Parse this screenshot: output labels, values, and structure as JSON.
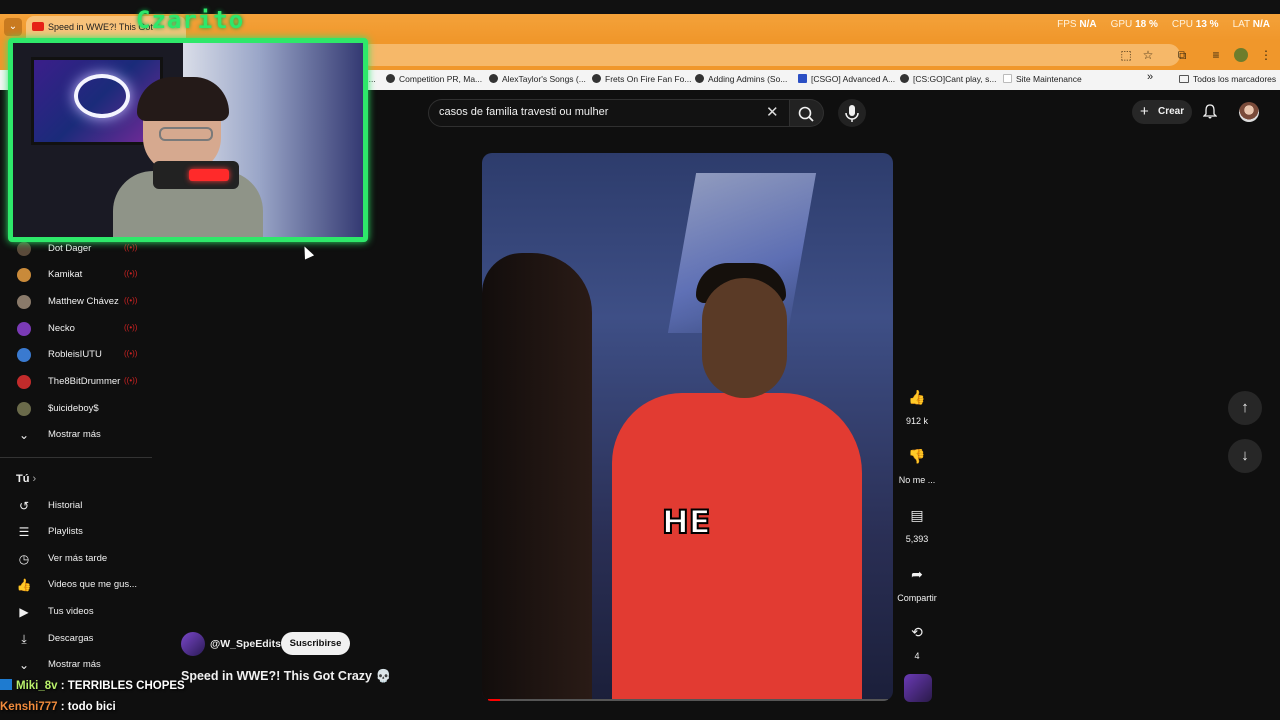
{
  "browser": {
    "tab_title": "Speed in WWE?! This Got",
    "stats": {
      "fps_label": "FPS",
      "fps_value": "N/A",
      "gpu_label": "GPU",
      "gpu_value": "18 %",
      "cpu_label": "CPU",
      "cpu_value": "13 %",
      "lat_label": "LAT",
      "lat_value": "N/A"
    },
    "bookmarks": [
      "G...",
      "Competition PR, Ma...",
      "AlexTaylor's Songs (...",
      "Frets On Fire Fan Fo...",
      "Adding Admins (So...",
      "[CSGO] Advanced A...",
      "[CS:GO]Cant play, s...",
      "Site Maintenance"
    ],
    "bookmarks_folder": "Todos los marcadores",
    "bookmarks_more": "»"
  },
  "youtube": {
    "search_value": "casos de familia travesti ou mulher",
    "create_label": "Crear"
  },
  "sidebar": {
    "channels": [
      {
        "name": "Dot Dager",
        "live": true,
        "color": "#5a4a3a"
      },
      {
        "name": "Kamikat",
        "live": true,
        "color": "#c98a3a"
      },
      {
        "name": "Matthew Chávez",
        "live": true,
        "color": "#8a7a6a"
      },
      {
        "name": "Necko",
        "live": true,
        "color": "#7a3ab5"
      },
      {
        "name": "RobleisIUTU",
        "live": true,
        "color": "#3a7ad0"
      },
      {
        "name": "The8BitDrummer",
        "live": true,
        "color": "#c22b2b"
      },
      {
        "name": "$uicideboy$",
        "live": false,
        "color": "#6a6a4a"
      }
    ],
    "live_glyph": "((•))",
    "show_more": "Mostrar más",
    "you_heading": "Tú",
    "you_items": [
      {
        "label": "Historial",
        "icon": "history-icon"
      },
      {
        "label": "Playlists",
        "icon": "playlists-icon"
      },
      {
        "label": "Ver más tarde",
        "icon": "watch-later-icon"
      },
      {
        "label": "Videos que me gus...",
        "icon": "liked-videos-icon"
      },
      {
        "label": "Tus videos",
        "icon": "your-videos-icon"
      },
      {
        "label": "Descargas",
        "icon": "downloads-icon"
      },
      {
        "label": "Mostrar más",
        "icon": "chevron-down-icon"
      }
    ]
  },
  "overlay": {
    "streamer_name": "Czarito"
  },
  "short": {
    "caption": "HE",
    "channel": "@W_SpeEdits",
    "subscribe_label": "Suscribirse",
    "title": "Speed in WWE?! This Got Crazy 💀",
    "likes": "912 k",
    "dislike_label": "No me ...",
    "comments": "5,393",
    "share_label": "Compartir",
    "remix_count": "4"
  },
  "chat": [
    {
      "user": "Miki_8v",
      "message": " : TERRIBLES CHOPES"
    },
    {
      "user": "Kenshi777",
      "message": " : todo bici"
    }
  ]
}
